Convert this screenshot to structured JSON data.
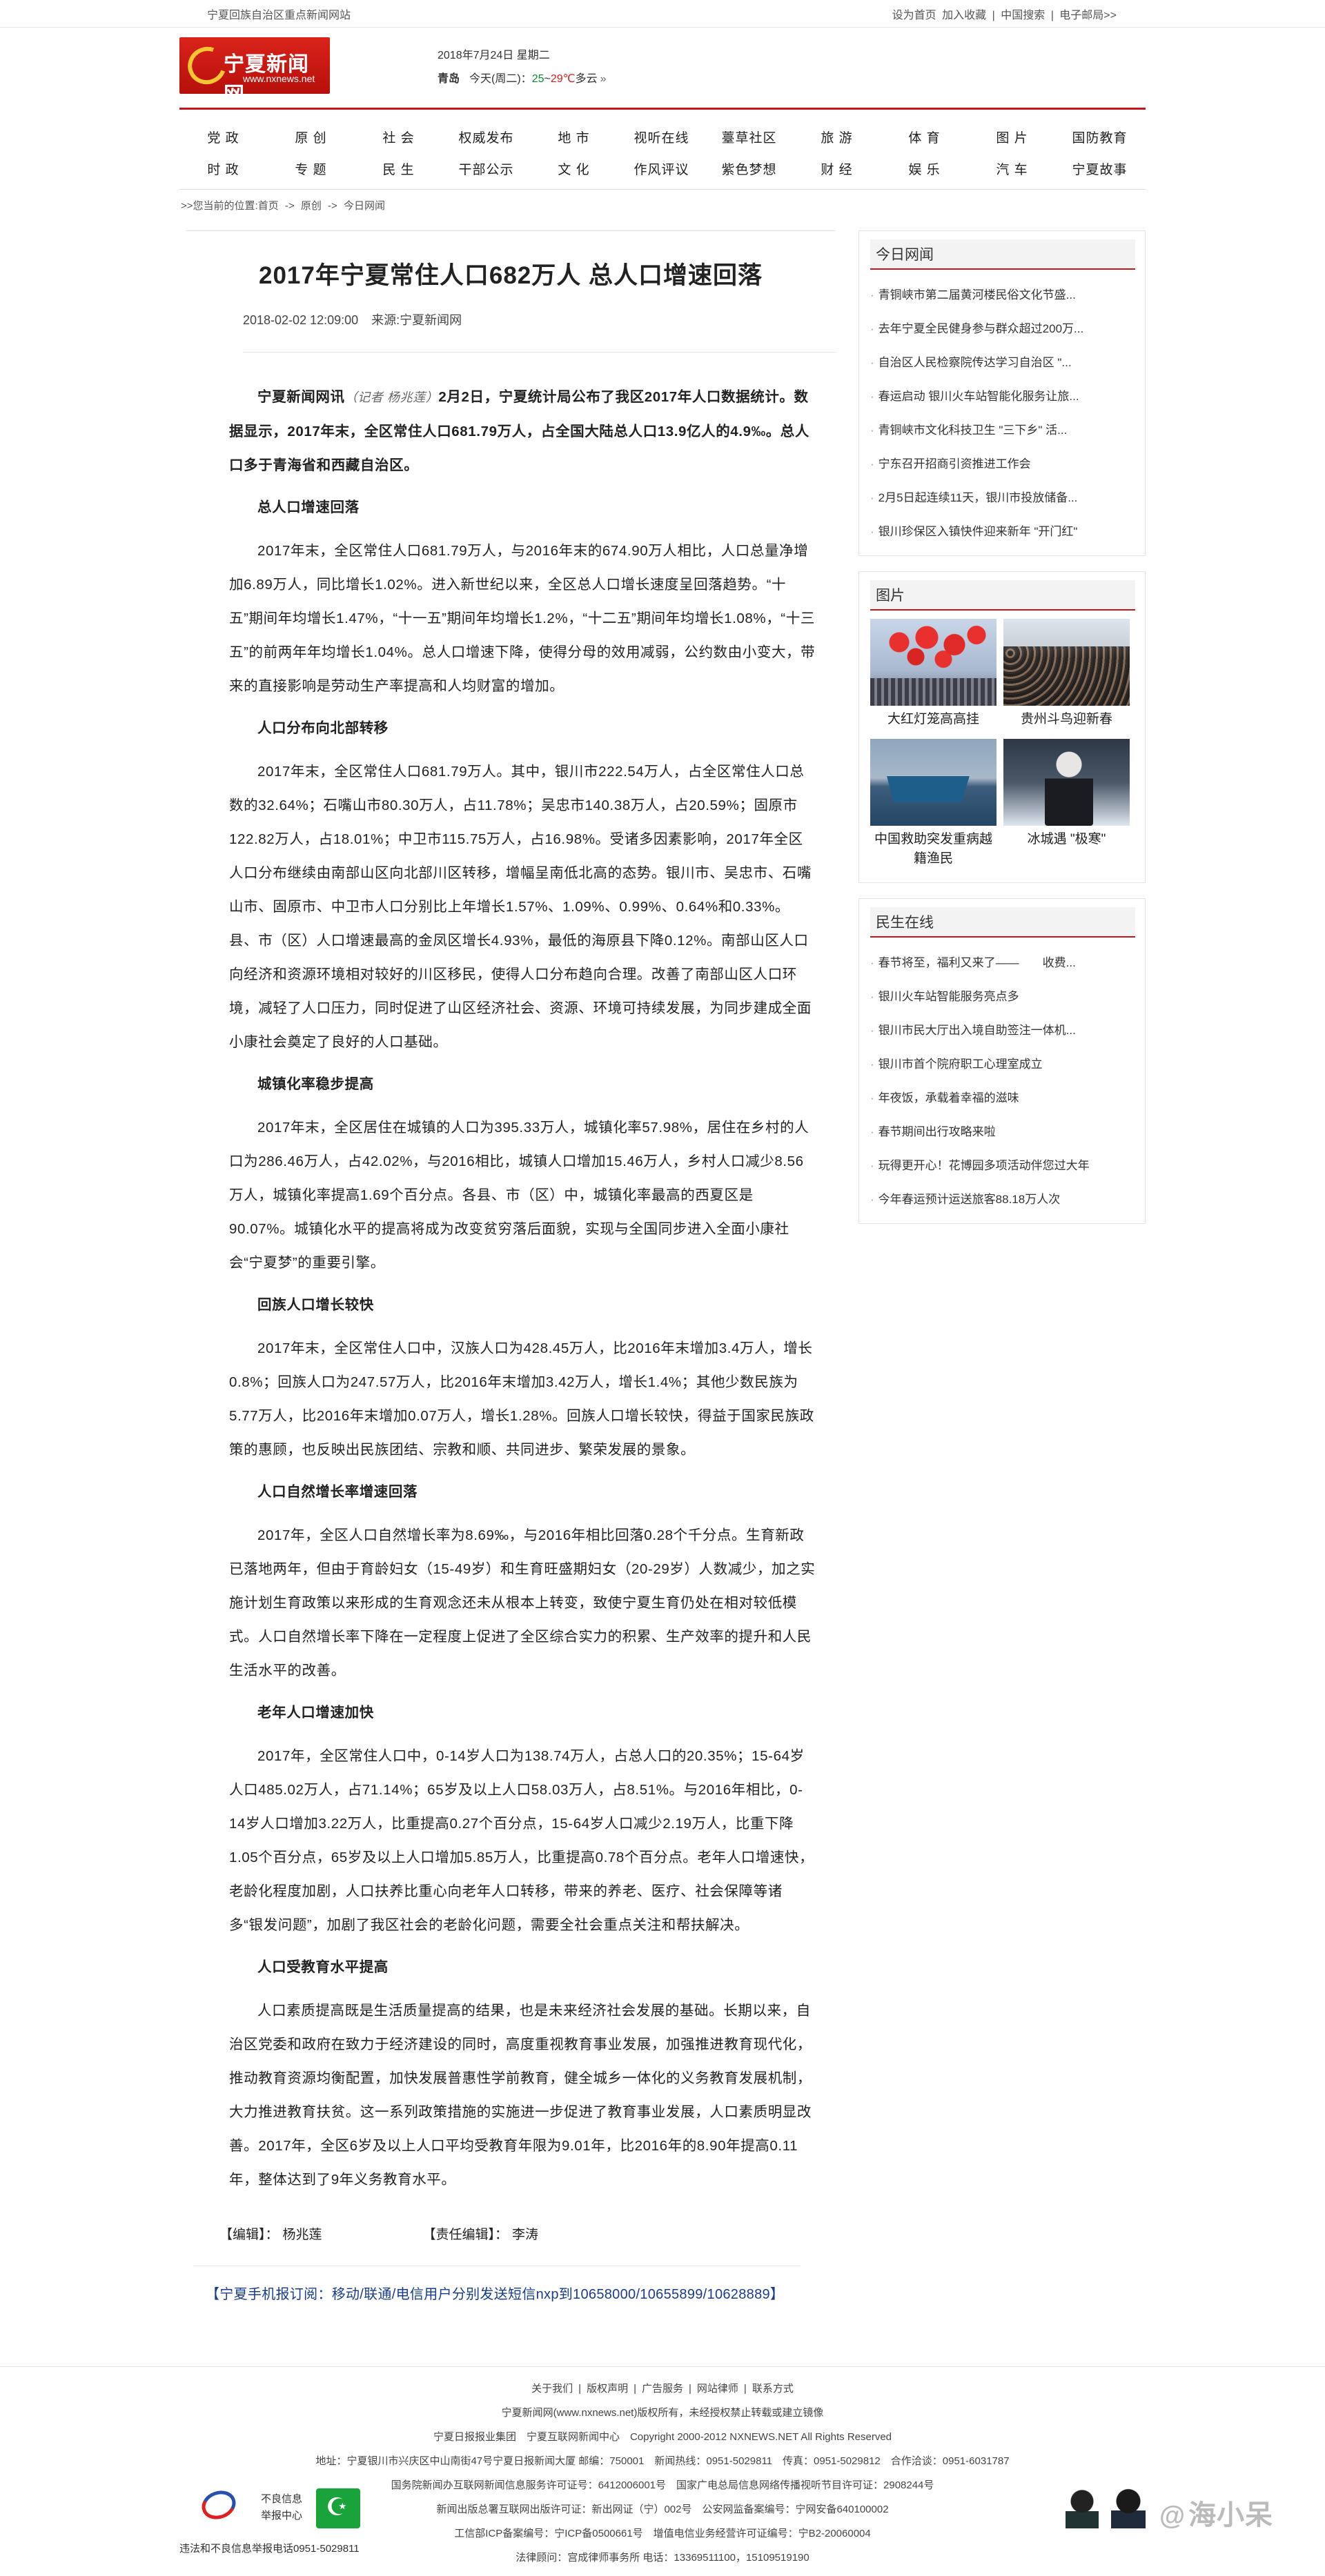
{
  "topbar": {
    "left": "宁夏回族自治区重点新闻网站",
    "links": [
      "设为首页",
      "加入收藏",
      "|",
      "中国搜索",
      "|",
      "电子邮局>>"
    ]
  },
  "header": {
    "logo_name": "宁夏新闻网",
    "logo_url": "www.nxnews.net",
    "date": "2018年7月24日 星期二",
    "city": "青岛",
    "weather_day": "今天(周二)：",
    "temp_low": "25",
    "temp_sep": "~",
    "temp_high": "29℃",
    "weather": "多云",
    "weather_more": "»"
  },
  "nav": {
    "row1": [
      "党 政",
      "原 创",
      "社 会",
      "权威发布",
      "地 市",
      "视听在线",
      "薹草社区",
      "旅 游",
      "体 育",
      "图 片",
      "国防教育"
    ],
    "row2": [
      "时 政",
      "专 题",
      "民 生",
      "干部公示",
      "文 化",
      "作风评议",
      "紫色梦想",
      "财 经",
      "娱 乐",
      "汽 车",
      "宁夏故事"
    ]
  },
  "breadcrumb": [
    ">>您当前的位置:首页",
    "->",
    "原创",
    "->",
    "今日网闻"
  ],
  "article": {
    "title": "2017年宁夏常住人口682万人 总人口增速回落",
    "time": "2018-02-02 12:09:00",
    "source": "来源:宁夏新闻网",
    "lead_start": "宁夏新闻网讯",
    "lead_reporter": "（记者 杨兆莲）",
    "lead_rest": "2月2日，宁夏统计局公布了我区2017年人口数据统计。数据显示，2017年末，全区常住人口681.79万人，占全国大陆总人口13.9亿人的4.9‰。总人口多于青海省和西藏自治区。",
    "sections": [
      {
        "heading": "总人口增速回落",
        "text": "2017年末，全区常住人口681.79万人，与2016年末的674.90万人相比，人口总量净增加6.89万人，同比增长1.02%。进入新世纪以来，全区总人口增长速度呈回落趋势。“十五”期间年均增长1.47%，“十一五”期间年均增长1.2%，“十二五”期间年均增长1.08%，“十三五”的前两年年均增长1.04%。总人口增速下降，使得分母的效用减弱，公约数由小变大，带来的直接影响是劳动生产率提高和人均财富的增加。"
      },
      {
        "heading": "人口分布向北部转移",
        "text": "2017年末，全区常住人口681.79万人。其中，银川市222.54万人，占全区常住人口总数的32.64%；石嘴山市80.30万人，占11.78%；吴忠市140.38万人，占20.59%；固原市122.82万人，占18.01%；中卫市115.75万人，占16.98%。受诸多因素影响，2017年全区人口分布继续由南部山区向北部川区转移，增幅呈南低北高的态势。银川市、吴忠市、石嘴山市、固原市、中卫市人口分别比上年增长1.57%、1.09%、0.99%、0.64%和0.33%。县、市（区）人口增速最高的金凤区增长4.93%，最低的海原县下降0.12%。南部山区人口向经济和资源环境相对较好的川区移民，使得人口分布趋向合理。改善了南部山区人口环境，减轻了人口压力，同时促进了山区经济社会、资源、环境可持续发展，为同步建成全面小康社会奠定了良好的人口基础。"
      },
      {
        "heading": "城镇化率稳步提高",
        "text": "2017年末，全区居住在城镇的人口为395.33万人，城镇化率57.98%，居住在乡村的人口为286.46万人，占42.02%，与2016相比，城镇人口增加15.46万人，乡村人口减少8.56万人，城镇化率提高1.69个百分点。各县、市（区）中，城镇化率最高的西夏区是90.07%。城镇化水平的提高将成为改变贫穷落后面貌，实现与全国同步进入全面小康社会“宁夏梦”的重要引擎。"
      },
      {
        "heading": "回族人口增长较快",
        "text": "2017年末，全区常住人口中，汉族人口为428.45万人，比2016年末增加3.4万人，增长0.8%；回族人口为247.57万人，比2016年末增加3.42万人，增长1.4%；其他少数民族为5.77万人，比2016年末增加0.07万人，增长1.28%。回族人口增长较快，得益于国家民族政策的惠顾，也反映出民族团结、宗教和顺、共同进步、繁荣发展的景象。"
      },
      {
        "heading": "人口自然增长率增速回落",
        "text": "2017年，全区人口自然增长率为8.69‰，与2016年相比回落0.28个千分点。生育新政已落地两年，但由于育龄妇女（15-49岁）和生育旺盛期妇女（20-29岁）人数减少，加之实施计划生育政策以来形成的生育观念还未从根本上转变，致使宁夏生育仍处在相对较低模式。人口自然增长率下降在一定程度上促进了全区综合实力的积累、生产效率的提升和人民生活水平的改善。"
      },
      {
        "heading": "老年人口增速加快",
        "text": "2017年，全区常住人口中，0-14岁人口为138.74万人，占总人口的20.35%；15-64岁人口485.02万人，占71.14%；65岁及以上人口58.03万人，占8.51%。与2016年相比，0-14岁人口增加3.22万人，比重提高0.27个百分点，15-64岁人口减少2.19万人，比重下降1.05个百分点，65岁及以上人口增加5.85万人，比重提高0.78个百分点。老年人口增速快，老龄化程度加剧，人口扶养比重心向老年人口转移，带来的养老、医疗、社会保障等诸多“银发问题”，加剧了我区社会的老龄化问题，需要全社会重点关注和帮扶解决。"
      },
      {
        "heading": "人口受教育水平提高",
        "text": "人口素质提高既是生活质量提高的结果，也是未来经济社会发展的基础。长期以来，自治区党委和政府在致力于经济建设的同时，高度重视教育事业发展，加强推进教育现代化，推动教育资源均衡配置，加快发展普惠性学前教育，健全城乡一体化的义务教育发展机制，大力推进教育扶贫。这一系列政策措施的实施进一步促进了教育事业发展，人口素质明显改善。2017年，全区6岁及以上人口平均受教育年限为9.01年，比2016年的8.90年提高0.11年，整体达到了9年义务教育水平。"
      }
    ],
    "editor_label": "【编辑】：",
    "editor": "杨兆莲",
    "chief_editor_label": "【责任编辑】：",
    "chief_editor": "李涛",
    "subscribe": "【宁夏手机报订阅：移动/联通/电信用户分别发送短信nxp到10658000/10655899/10628889】"
  },
  "sidebar": {
    "today_title": "今日网闻",
    "today": [
      "青铜峡市第二届黄河楼民俗文化节盛...",
      "去年宁夏全民健身参与群众超过200万...",
      "自治区人民检察院传达学习自治区 \"...",
      "春运启动 银川火车站智能化服务让旅...",
      "青铜峡市文化科技卫生 \"三下乡\" 活...",
      "宁东召开招商引资推进工作会",
      "2月5日起连续11天，银川市投放储备...",
      "银川珍保区入镇快件迎来新年 \"开门红\""
    ],
    "pics_title": "图片",
    "pics": [
      {
        "caption": "大红灯笼高高挂"
      },
      {
        "caption": "贵州斗鸟迎新春"
      },
      {
        "caption": "中国救助突发重病越籍渔民"
      },
      {
        "caption": "冰城遇 \"极寒\""
      }
    ],
    "life_title": "民生在线",
    "life": [
      "春节将至，福利又来了——　　收费...",
      "银川火车站智能服务亮点多",
      "银川市民大厅出入境自助签注一体机...",
      "银川市首个院府职工心理室成立",
      "年夜饭，承载着幸福的滋味",
      "春节期间出行攻略来啦",
      "玩得更开心！花博园多项活动伴您过大年",
      "今年春运预计运送旅客88.18万人次"
    ]
  },
  "footer": {
    "links": [
      "关于我们",
      "|",
      "版权声明",
      "|",
      "广告服务",
      "|",
      "网站律师",
      "|",
      "联系方式"
    ],
    "copy1": "宁夏新闻网(www.nxnews.net)版权所有，未经授权禁止转载或建立镜像",
    "copy2": "宁夏日报报业集团　宁夏互联网新闻中心　Copyright 2000-2012 NXNEWS.NET All Rights Reserved",
    "addr": "地址：宁夏银川市兴庆区中山南街47号宁夏日报新闻大厦 邮编：750001　新闻热线：0951-5029811　传真：0951-5029812　合作洽谈：0951-6031787",
    "lic1": "国务院新闻办互联网新闻信息服务许可证号：6412006001号　国家广电总局信息网络传播视听节目许可证：2908244号",
    "lic2": "新闻出版总署互联网出版许可证：新出网证（宁）002号　公安网监备案编号：宁网安备640100002",
    "lic3": "工信部ICP备案编号：宁ICP备0500661号　增值电信业务经营许可证编号：宁B2-20060004",
    "lic4": "法律顾问：宫成律师事务所 电话：13369511100，15109519190",
    "badge_text_1": "不良信息",
    "badge_text_2": "举报中心",
    "report": "违法和不良信息举报电话0951-5029811",
    "watermark_at": "@",
    "watermark": "海小呆"
  },
  "colors": {
    "brand_red": "#c8151c",
    "subscribe_blue": "#1a3c8f",
    "temp_low": "#0a8a2a",
    "temp_high": "#e01a1a"
  }
}
